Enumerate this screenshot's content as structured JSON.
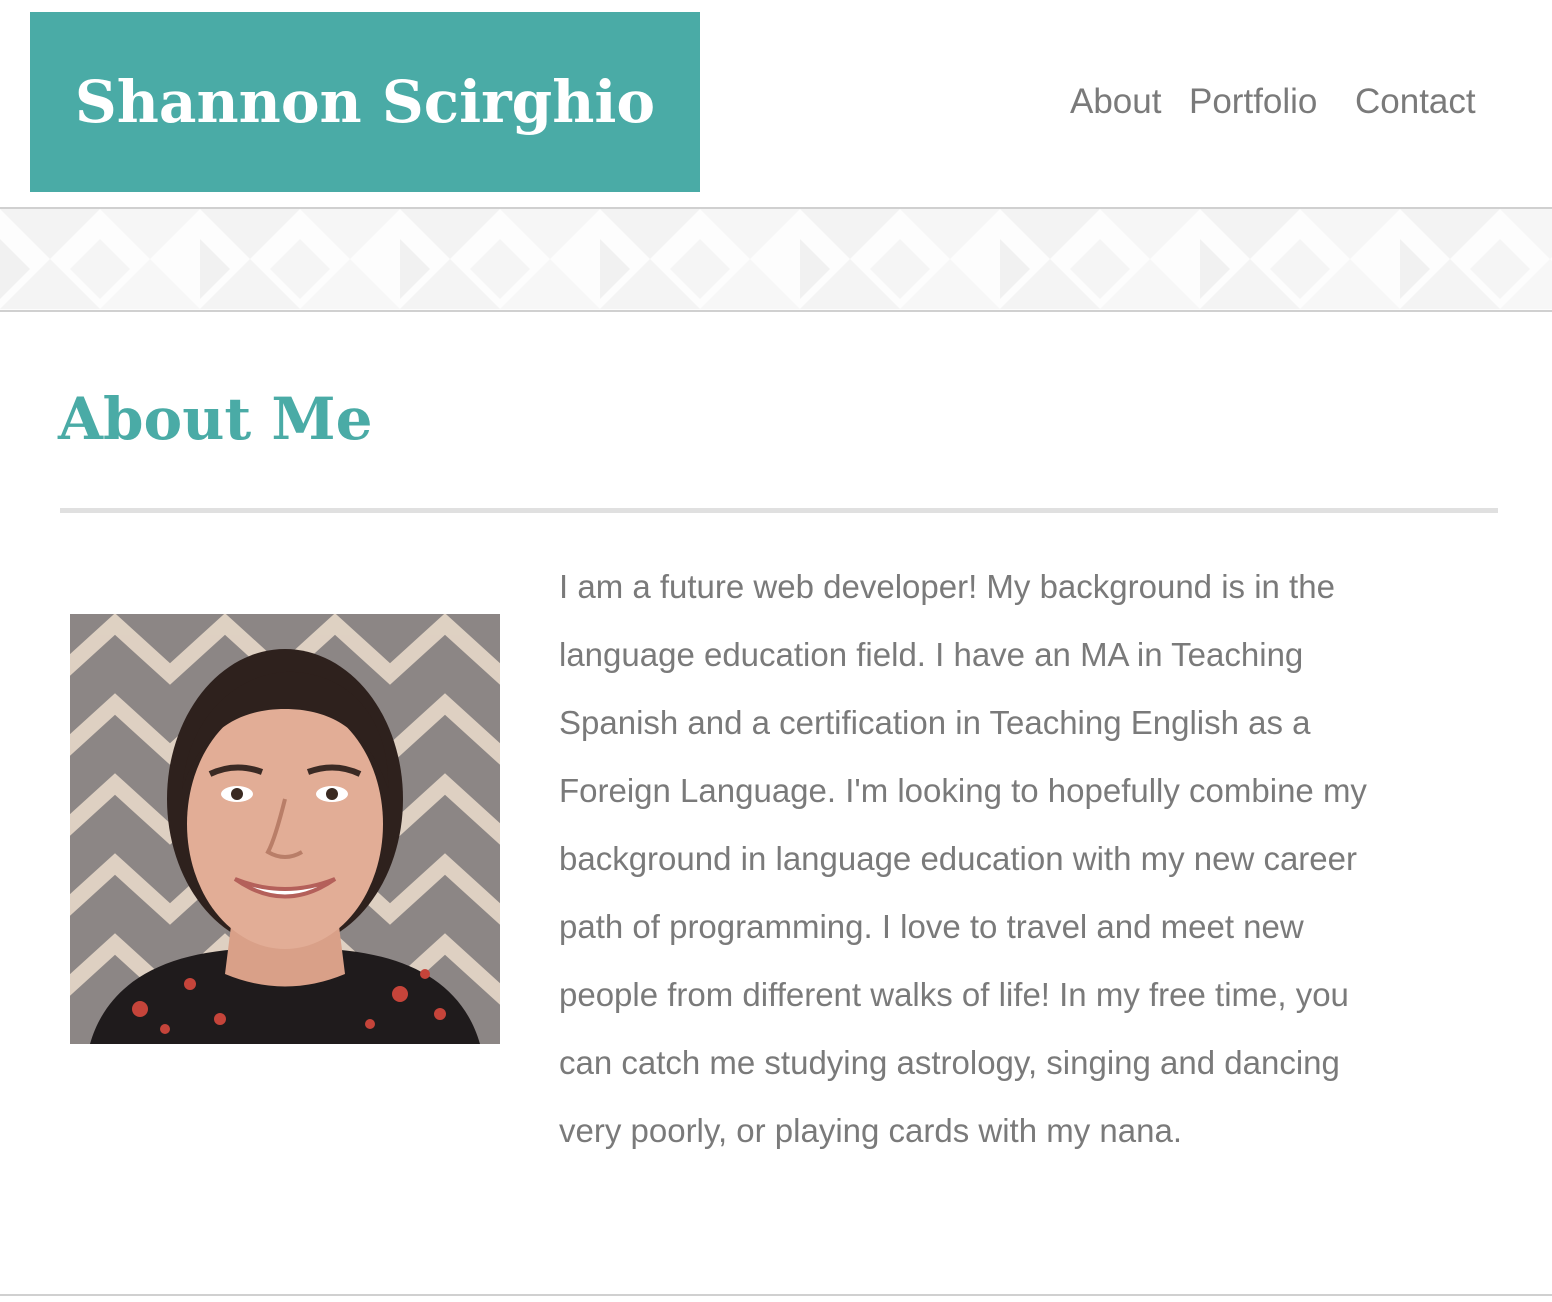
{
  "header": {
    "brand_name": "Shannon Scirghio",
    "brand_color": "#4aaba6",
    "nav": {
      "about": "About",
      "portfolio": "Portfolio",
      "contact": "Contact"
    }
  },
  "about": {
    "title": "About Me",
    "photo_alt": "Portrait photo of Shannon Scirghio",
    "bio": "I am a future web developer! My background is in the language education field. I have an MA in Teaching Spanish and a certification in Teaching English as a Foreign Language. I'm looking to hopefully combine my background in language education with my new career path of programming. I love to travel and meet new people from different walks of life! In my free time, you can catch me studying astrology, singing and dancing very poorly, or playing cards with my nana."
  },
  "colors": {
    "accent": "#4aaba6",
    "text": "#7a7a7a",
    "rule": "#e0e0e0"
  }
}
